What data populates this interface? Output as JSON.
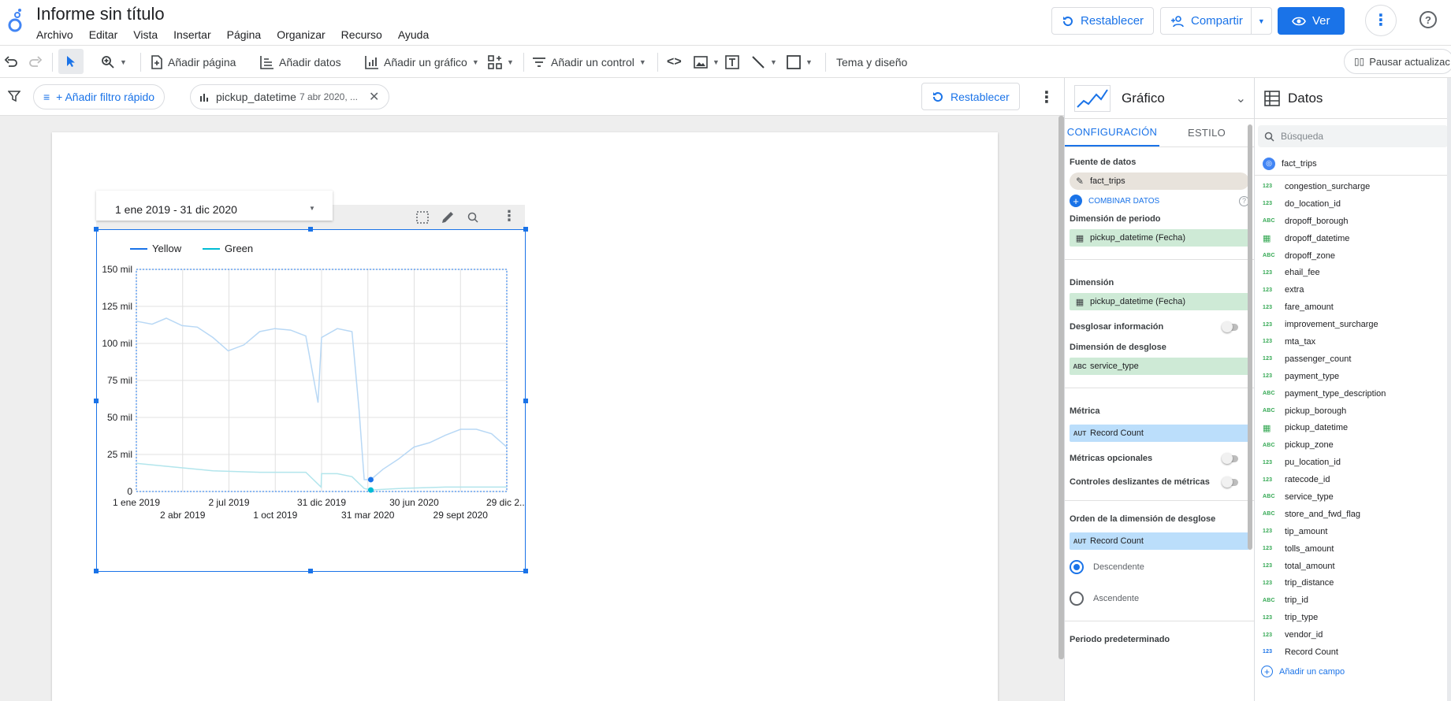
{
  "app": {
    "doc_title": "Informe sin título",
    "menu": [
      "Archivo",
      "Editar",
      "Vista",
      "Insertar",
      "Página",
      "Organizar",
      "Recurso",
      "Ayuda"
    ],
    "reset_label": "Restablecer",
    "share_label": "Compartir",
    "view_label": "Ver"
  },
  "toolbar": {
    "add_page": "Añadir página",
    "add_data": "Añadir datos",
    "add_chart": "Añadir un gráfico",
    "add_control": "Añadir un control",
    "theme": "Tema y diseño",
    "pause": "Pausar actualizac"
  },
  "filterbar": {
    "quick_filter": "+ Añadir filtro rápido",
    "chip_field": "pickup_datetime",
    "chip_value": "7 abr 2020, ...",
    "reset_label": "Restablecer"
  },
  "date_control": {
    "value": "1 ene 2019 - 31 dic 2020"
  },
  "chart_data": {
    "type": "line",
    "legend": [
      "Yellow",
      "Green"
    ],
    "legend_position": "top",
    "colors": {
      "Yellow": "#1a73e8",
      "Green": "#00bcd4"
    },
    "ylim": [
      0,
      150000
    ],
    "y_ticks": [
      "0",
      "25 mil",
      "50 mil",
      "75 mil",
      "100 mil",
      "125 mil",
      "150 mil"
    ],
    "x_ticks_row1": [
      "1 ene 2019",
      "2 jul 2019",
      "31 dic 2019",
      "30 jun 2020",
      "29 dic 2..."
    ],
    "x_ticks_row2": [
      "2 abr 2019",
      "1 oct 2019",
      "31 mar 2020",
      "29 sept 2020"
    ],
    "x_range": [
      "2019-01-01",
      "2020-12-31"
    ],
    "grid": true,
    "series": [
      {
        "name": "Yellow",
        "x": [
          "2019-01-01",
          "2019-02-01",
          "2019-03-01",
          "2019-04-01",
          "2019-05-01",
          "2019-06-01",
          "2019-07-01",
          "2019-08-01",
          "2019-09-01",
          "2019-10-01",
          "2019-11-01",
          "2019-12-01",
          "2019-12-25",
          "2020-01-01",
          "2020-02-01",
          "2020-03-01",
          "2020-03-15",
          "2020-03-25",
          "2020-04-07",
          "2020-05-01",
          "2020-06-01",
          "2020-07-01",
          "2020-08-01",
          "2020-09-01",
          "2020-10-01",
          "2020-11-01",
          "2020-12-01",
          "2020-12-31"
        ],
        "values": [
          115000,
          113000,
          117000,
          112000,
          111000,
          104000,
          95000,
          99000,
          108000,
          110000,
          109000,
          105000,
          60000,
          104000,
          110000,
          108000,
          55000,
          8000,
          8000,
          15000,
          22000,
          30000,
          33000,
          38000,
          42000,
          42000,
          39000,
          30000
        ]
      },
      {
        "name": "Green",
        "x": [
          "2019-01-01",
          "2019-03-01",
          "2019-06-01",
          "2019-09-01",
          "2019-12-01",
          "2019-12-31",
          "2020-01-01",
          "2020-02-01",
          "2020-03-01",
          "2020-03-25",
          "2020-04-07",
          "2020-06-01",
          "2020-09-01",
          "2020-12-31"
        ],
        "values": [
          19000,
          17000,
          14000,
          13000,
          13000,
          3000,
          12000,
          12000,
          10000,
          2000,
          1000,
          2000,
          3000,
          3000
        ]
      }
    ]
  },
  "props": {
    "title": "Gráfico",
    "tab_config": "CONFIGURACIÓN",
    "tab_style": "ESTILO",
    "data_source_label": "Fuente de datos",
    "data_source": "fact_trips",
    "combine": "COMBINAR DATOS",
    "period_dim_label": "Dimensión de periodo",
    "period_dim": "pickup_datetime (Fecha)",
    "dim_label": "Dimensión",
    "dim": "pickup_datetime (Fecha)",
    "drill_label": "Desglosar información",
    "breakdown_label": "Dimensión de desglose",
    "breakdown": "service_type",
    "metric_label": "Métrica",
    "metric": "Record Count",
    "opt_metrics": "Métricas opcionales",
    "slider_metrics": "Controles deslizantes de métricas",
    "order_label": "Orden de la dimensión de desglose",
    "order_metric": "Record Count",
    "desc": "Descendente",
    "asc": "Ascendente",
    "default_period": "Periodo predeterminado",
    "type_badge_date": "📅",
    "type_badge_abc": "ABC",
    "type_badge_aut": "AUT"
  },
  "data_panel": {
    "title": "Datos",
    "search_placeholder": "Búsqueda",
    "source": "fact_trips",
    "fields": [
      {
        "type": "123",
        "name": "congestion_surcharge"
      },
      {
        "type": "123",
        "name": "do_location_id"
      },
      {
        "type": "ABC",
        "name": "dropoff_borough"
      },
      {
        "type": "date",
        "name": "dropoff_datetime"
      },
      {
        "type": "ABC",
        "name": "dropoff_zone"
      },
      {
        "type": "123",
        "name": "ehail_fee"
      },
      {
        "type": "123",
        "name": "extra"
      },
      {
        "type": "123",
        "name": "fare_amount"
      },
      {
        "type": "123",
        "name": "improvement_surcharge"
      },
      {
        "type": "123",
        "name": "mta_tax"
      },
      {
        "type": "123",
        "name": "passenger_count"
      },
      {
        "type": "123",
        "name": "payment_type"
      },
      {
        "type": "ABC",
        "name": "payment_type_description"
      },
      {
        "type": "ABC",
        "name": "pickup_borough"
      },
      {
        "type": "date",
        "name": "pickup_datetime"
      },
      {
        "type": "ABC",
        "name": "pickup_zone"
      },
      {
        "type": "123",
        "name": "pu_location_id"
      },
      {
        "type": "123",
        "name": "ratecode_id"
      },
      {
        "type": "ABC",
        "name": "service_type"
      },
      {
        "type": "ABC",
        "name": "store_and_fwd_flag"
      },
      {
        "type": "123",
        "name": "tip_amount"
      },
      {
        "type": "123",
        "name": "tolls_amount"
      },
      {
        "type": "123",
        "name": "total_amount"
      },
      {
        "type": "123",
        "name": "trip_distance"
      },
      {
        "type": "ABC",
        "name": "trip_id"
      },
      {
        "type": "123",
        "name": "trip_type"
      },
      {
        "type": "123",
        "name": "vendor_id"
      },
      {
        "type": "123b",
        "name": "Record Count"
      }
    ],
    "add_field": "Añadir un campo"
  }
}
